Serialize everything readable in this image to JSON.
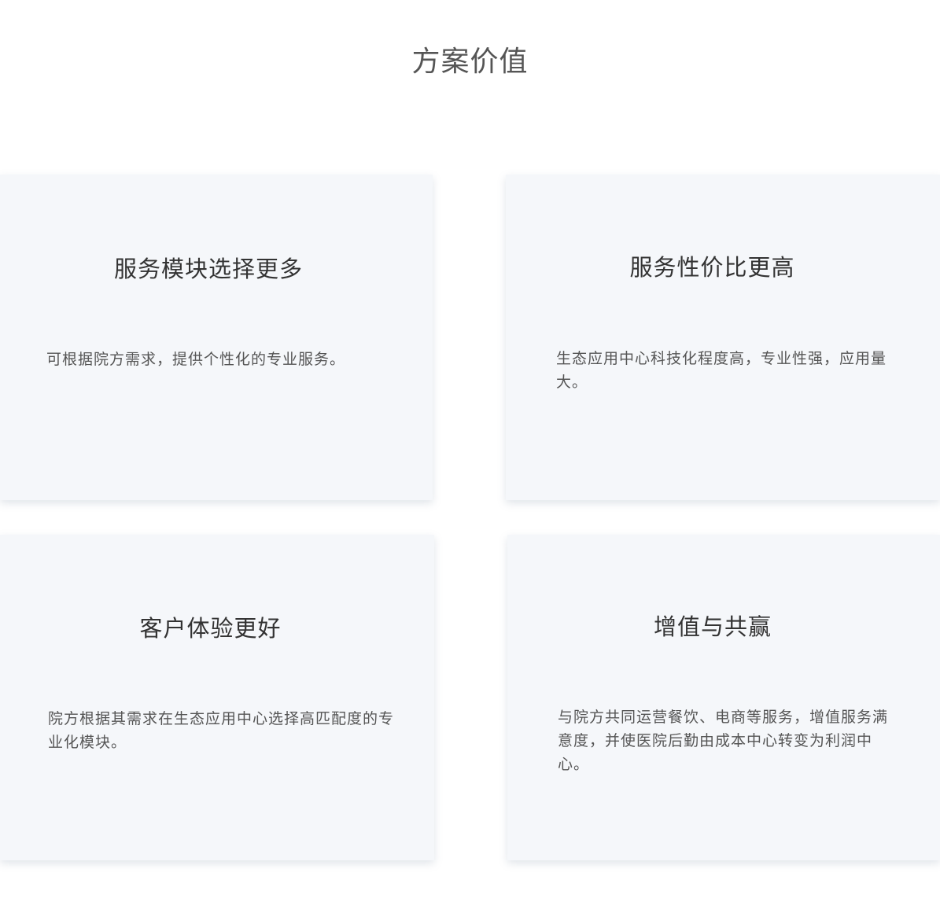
{
  "page": {
    "title": "方案价值"
  },
  "cards": [
    {
      "title": "服务模块选择更多",
      "description": "可根据院方需求，提供个性化的专业服务。"
    },
    {
      "title": "服务性价比更高",
      "description": "生态应用中心科技化程度高，专业性强，应用量大。"
    },
    {
      "title": "客户体验更好",
      "description": "院方根据其需求在生态应用中心选择高匹配度的专业化模块。"
    },
    {
      "title": "增值与共赢",
      "description": "与院方共同运营餐饮、电商等服务，增值服务满意度，并使医院后勤由成本中心转变为利润中心。"
    }
  ],
  "colors": {
    "background": "#ffffff",
    "card_background": "#f5f7fa",
    "title_text": "#555555",
    "card_title_text": "#333333",
    "body_text": "#555555"
  }
}
